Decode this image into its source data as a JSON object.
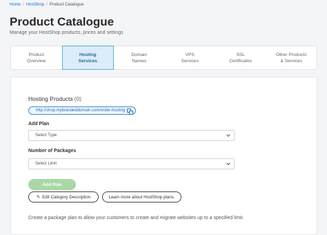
{
  "breadcrumb": [
    "Home",
    "HostShop",
    "Product Catalogue"
  ],
  "page": {
    "title": "Product Catalogue",
    "subtitle": "Manage your HostShop products, prices and settings"
  },
  "tabs": [
    {
      "line1": "Product",
      "line2": "Overview"
    },
    {
      "line1": "Hosting",
      "line2": "Services",
      "active": true
    },
    {
      "line1": "Domain",
      "line2": "Names"
    },
    {
      "line1": "VPS",
      "line2": "Services"
    },
    {
      "line1": "SSL",
      "line2": "Certificates"
    },
    {
      "line1": "Other Products",
      "line2": "& Services"
    }
  ],
  "panel": {
    "products_title": "Hosting Products",
    "products_count": "(0)",
    "order_url": "http://shop.mybrandeddomain.com/order-hosting",
    "add_plan_label": "Add Plan",
    "add_plan_placeholder": "Select Type",
    "packages_label": "Number of Packages",
    "packages_placeholder": "Select Limit",
    "add_plan_button": "Add Plan",
    "edit_category_button": "Edit Category Description",
    "learn_more_button": "Learn more about HostShop plans.",
    "help_text": "Create a package plan to allow your customers to create and migrate websites up to a specified limit."
  },
  "colors": {
    "accent_blue": "#1a6fd1",
    "active_tab_bg": "#dcecf8",
    "active_tab_border": "#5ab0d8",
    "add_plan_disabled": "#a9d8a6"
  },
  "icons": {
    "copy": "copy-icon",
    "pencil": "pencil-icon",
    "chevron": "chevron-down-icon"
  }
}
